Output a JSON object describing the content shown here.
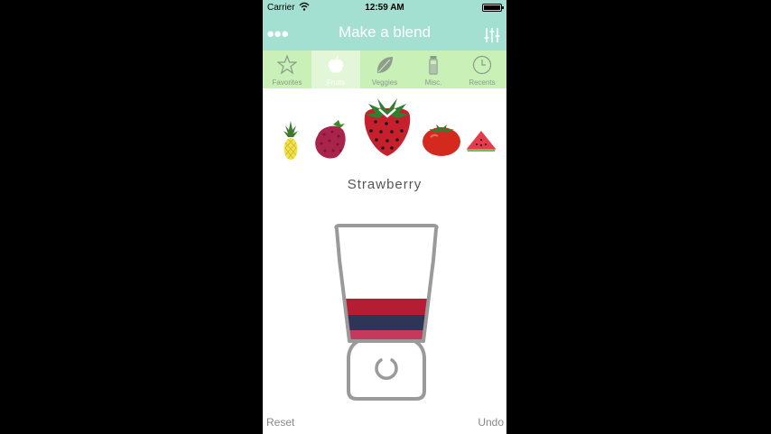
{
  "status_bar": {
    "carrier": "Carrier",
    "time": "12:59 AM"
  },
  "nav": {
    "title": "Make a blend",
    "menu_icon": "more-dots-icon",
    "settings_icon": "sliders-icon"
  },
  "tabs": [
    {
      "label": "Favorites",
      "icon": "star-icon",
      "active": false
    },
    {
      "label": "Fruits",
      "icon": "apple-icon",
      "active": true
    },
    {
      "label": "Veggies",
      "icon": "leaf-icon",
      "active": false
    },
    {
      "label": "Misc.",
      "icon": "bottle-icon",
      "active": false
    },
    {
      "label": "Recents",
      "icon": "clock-icon",
      "active": false
    }
  ],
  "carousel": {
    "selected": "Strawberry"
  },
  "blender": {
    "layers": [
      {
        "color": "#b51d35"
      },
      {
        "color": "#2e3556"
      },
      {
        "color": "#c53a5c"
      }
    ]
  },
  "footer": {
    "reset_label": "Reset",
    "undo_label": "Undo"
  }
}
